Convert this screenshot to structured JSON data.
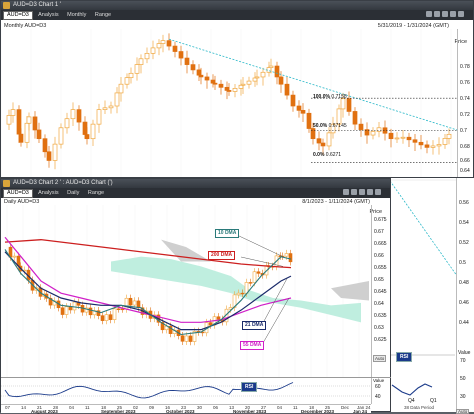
{
  "window1": {
    "title": "AUD=D3 Chart 1 '",
    "symbol": "AUD=D3",
    "toolbar": [
      "Analysis",
      "Monthly",
      "Range"
    ],
    "chart_title": "Monthly AUD=D3",
    "date_range": "5/31/2019 - 1/31/2024 (GMT)",
    "price_label": "Price",
    "y_ticks": [
      "0.78",
      "0.76",
      "0.74",
      "0.72",
      "0.7",
      "0.68",
      "0.66",
      "0.64",
      "0.62"
    ],
    "fib": {
      "level_100": "100.0%",
      "value_100": "0.7158",
      "level_50": "50.0%",
      "value_50": "0.67145",
      "level_0": "0.0%",
      "value_0": "0.6271"
    }
  },
  "window2": {
    "title": "AUD=D3 Chart 2 ' : AUD=D3 Chart (')",
    "symbol": "AUD=D3",
    "toolbar": [
      "Analysis",
      "Daily",
      "Range"
    ],
    "chart_title": "Daily AUD=D3",
    "date_range": "8/1/2023 - 1/11/2024 (GMT)",
    "price_label": "Price",
    "y_ticks": [
      "0.675",
      "0.67",
      "0.665",
      "0.66",
      "0.655",
      "0.65",
      "0.645",
      "0.64",
      "0.635",
      "0.63",
      "0.625"
    ],
    "labels": {
      "dma10": "10 DMA",
      "dma200": "200 DMA",
      "dma21": "21 DMA",
      "dma55": "55 DMA",
      "rsi": "RSI"
    },
    "value_label": "Value",
    "rsi_ticks": [
      "60",
      "40"
    ],
    "x_labels": [
      "07",
      "14",
      "21",
      "28",
      "04",
      "11",
      "18",
      "25",
      "02",
      "09",
      "16",
      "23",
      "30",
      "06",
      "13",
      "20",
      "27",
      "04",
      "11",
      "18",
      "25",
      "Dec",
      "Jan 24"
    ],
    "month_labels": [
      "August 2023",
      "September 2023",
      "October 2023",
      "November 2023",
      "December 2023",
      "Jan 24"
    ],
    "autoscale": "Auto"
  },
  "background_right": {
    "y_ticks": [
      "0.56",
      "0.54",
      "0.52",
      "0.5",
      "0.48",
      "0.46",
      "0.44"
    ],
    "value_label": "Value",
    "rsi_label": "RSI",
    "rsi_ticks": [
      "70",
      "50",
      "30"
    ],
    "x_labels": [
      "Q4",
      "Q1"
    ],
    "period_label": "38 Data Period",
    "autoscale": "Auto"
  },
  "colors": {
    "dma10": "#2a7a7a",
    "dma200": "#cc1f1f",
    "dma21": "#1a2a6a",
    "dma55": "#d020c8",
    "cloud": "#b8ecdc",
    "trendline": "#2ab8c8",
    "candle_up": "#f0a840",
    "candle_down": "#e07010"
  }
}
